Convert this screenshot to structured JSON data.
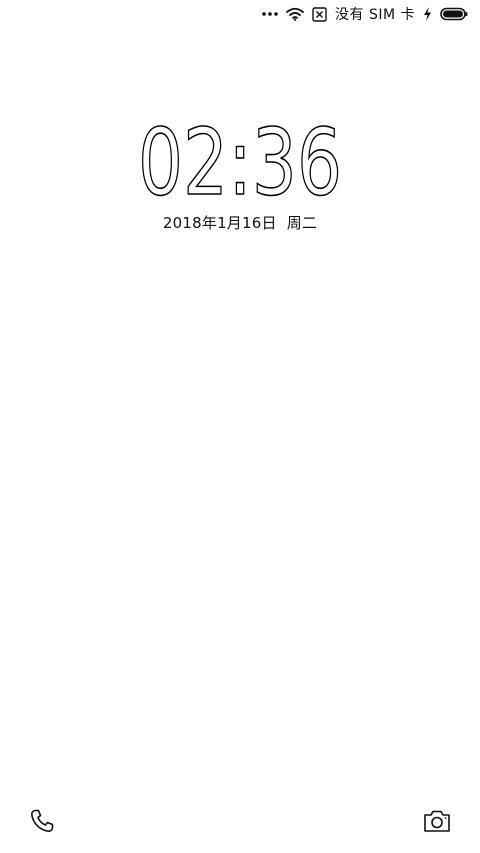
{
  "status_bar": {
    "more_icon": "more-dots-icon",
    "wifi_icon": "wifi-icon",
    "sim_icon": "no-sim-icon",
    "carrier_text": "没有 SIM 卡",
    "charging_icon": "charging-bolt-icon",
    "battery_icon": "battery-icon",
    "battery_level": 0.95
  },
  "lock_screen": {
    "time": "02:36",
    "date": "2018年1月16日",
    "weekday": "周二"
  },
  "shortcuts": {
    "left_icon": "phone-icon",
    "right_icon": "camera-icon"
  },
  "colors": {
    "background": "#ffffff",
    "foreground": "#000000"
  }
}
